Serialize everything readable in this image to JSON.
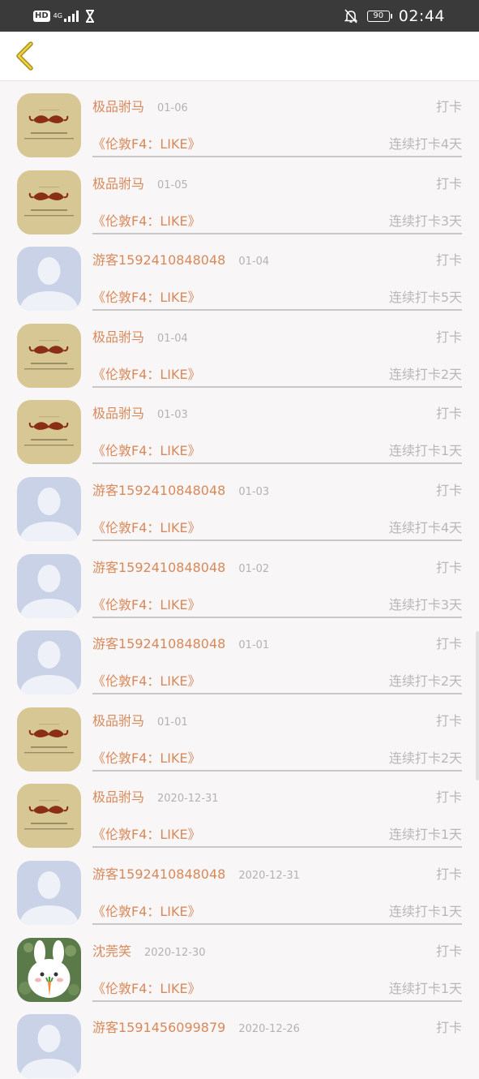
{
  "status_bar": {
    "hd": "HD",
    "network": "4G",
    "battery": "90",
    "time": "02:44"
  },
  "list": [
    {
      "avatar": "mustache",
      "name": "极品驸马",
      "date": "01-06",
      "action": "打卡",
      "title": "《伦敦F4：LIKE》",
      "streak": "连续打卡4天"
    },
    {
      "avatar": "mustache",
      "name": "极品驸马",
      "date": "01-05",
      "action": "打卡",
      "title": "《伦敦F4：LIKE》",
      "streak": "连续打卡3天"
    },
    {
      "avatar": "default",
      "name": "游客1592410848048",
      "date": "01-04",
      "action": "打卡",
      "title": "《伦敦F4：LIKE》",
      "streak": "连续打卡5天"
    },
    {
      "avatar": "mustache",
      "name": "极品驸马",
      "date": "01-04",
      "action": "打卡",
      "title": "《伦敦F4：LIKE》",
      "streak": "连续打卡2天"
    },
    {
      "avatar": "mustache",
      "name": "极品驸马",
      "date": "01-03",
      "action": "打卡",
      "title": "《伦敦F4：LIKE》",
      "streak": "连续打卡1天"
    },
    {
      "avatar": "default",
      "name": "游客1592410848048",
      "date": "01-03",
      "action": "打卡",
      "title": "《伦敦F4：LIKE》",
      "streak": "连续打卡4天"
    },
    {
      "avatar": "default",
      "name": "游客1592410848048",
      "date": "01-02",
      "action": "打卡",
      "title": "《伦敦F4：LIKE》",
      "streak": "连续打卡3天"
    },
    {
      "avatar": "default",
      "name": "游客1592410848048",
      "date": "01-01",
      "action": "打卡",
      "title": "《伦敦F4：LIKE》",
      "streak": "连续打卡2天"
    },
    {
      "avatar": "mustache",
      "name": "极品驸马",
      "date": "01-01",
      "action": "打卡",
      "title": "《伦敦F4：LIKE》",
      "streak": "连续打卡2天"
    },
    {
      "avatar": "mustache",
      "name": "极品驸马",
      "date": "2020-12-31",
      "action": "打卡",
      "title": "《伦敦F4：LIKE》",
      "streak": "连续打卡1天"
    },
    {
      "avatar": "default",
      "name": "游客1592410848048",
      "date": "2020-12-31",
      "action": "打卡",
      "title": "《伦敦F4：LIKE》",
      "streak": "连续打卡1天"
    },
    {
      "avatar": "bunny",
      "name": "沈莞笑",
      "date": "2020-12-30",
      "action": "打卡",
      "title": "《伦敦F4：LIKE》",
      "streak": "连续打卡1天"
    },
    {
      "avatar": "default",
      "name": "游客1591456099879",
      "date": "2020-12-26",
      "action": "打卡",
      "title": "",
      "streak": ""
    }
  ]
}
